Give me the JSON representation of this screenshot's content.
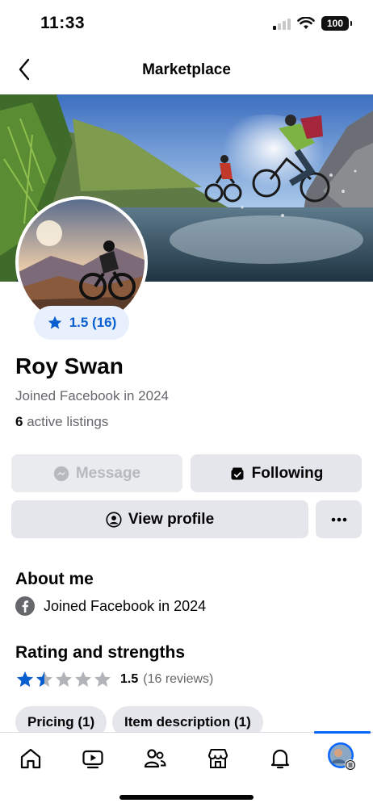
{
  "status_bar": {
    "time": "11:33",
    "battery": "100"
  },
  "nav": {
    "title": "Marketplace"
  },
  "profile": {
    "rating_badge": "1.5 (16)",
    "name": "Roy Swan",
    "joined": "Joined Facebook in 2024",
    "listings_count": "6",
    "listings_label": "active listings"
  },
  "actions": {
    "message": "Message",
    "following": "Following",
    "view_profile": "View profile"
  },
  "about": {
    "title": "About me",
    "joined": "Joined Facebook in 2024"
  },
  "rating": {
    "title": "Rating and strengths",
    "score": "1.5",
    "reviews": "(16 reviews)",
    "stars_value": 1.5,
    "stars_max": 5
  },
  "strengths": [
    {
      "label": "Pricing (1)"
    },
    {
      "label": "Item description (1)"
    }
  ],
  "tabs": [
    "home-icon",
    "video-icon",
    "friends-icon",
    "marketplace-icon",
    "bell-icon",
    "profile-icon"
  ],
  "colors": {
    "accent": "#0866ff",
    "badge_bg": "#e7f0fc",
    "button_bg": "#e4e6eb",
    "secondary_text": "#65676b"
  }
}
